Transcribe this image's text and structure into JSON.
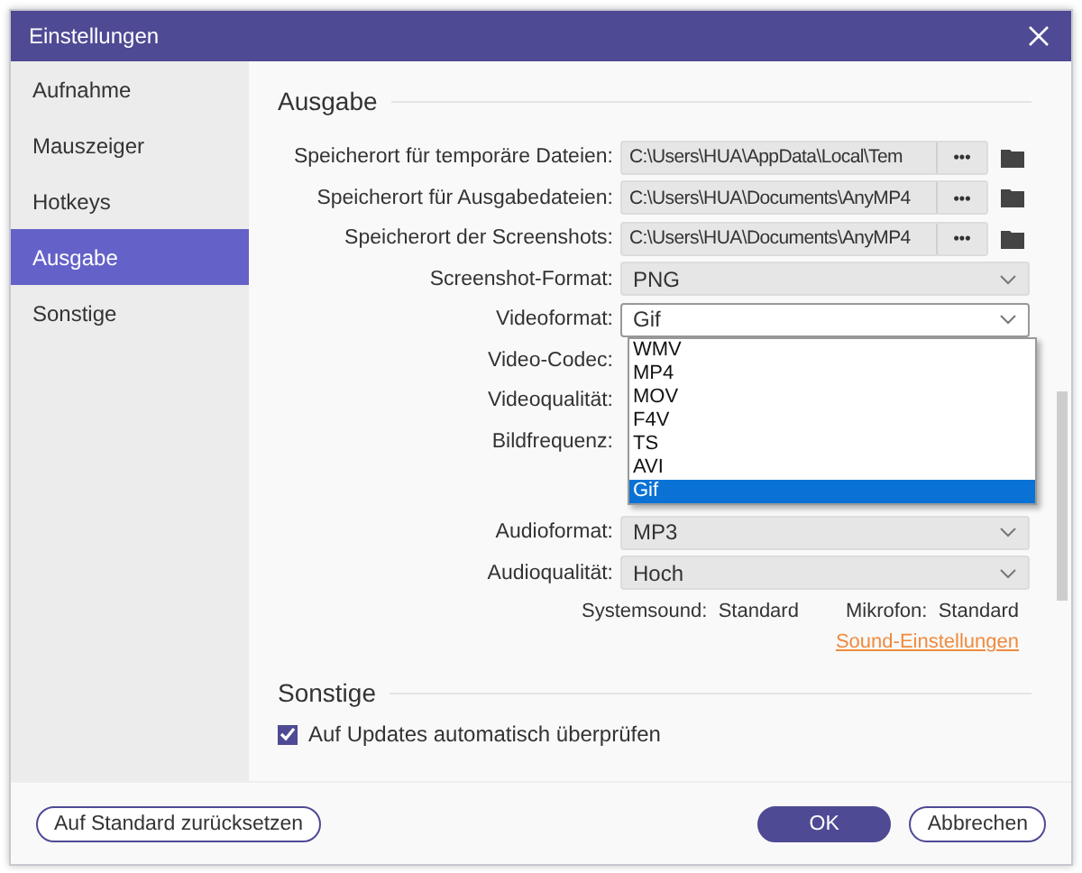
{
  "window": {
    "title": "Einstellungen"
  },
  "sidebar": {
    "items": [
      {
        "label": "Aufnahme",
        "selected": false
      },
      {
        "label": "Mauszeiger",
        "selected": false
      },
      {
        "label": "Hotkeys",
        "selected": false
      },
      {
        "label": "Ausgabe",
        "selected": true
      },
      {
        "label": "Sonstige",
        "selected": false
      }
    ]
  },
  "output": {
    "heading": "Ausgabe",
    "rows": [
      {
        "kind": "path",
        "label": "Speicherort für temporäre Dateien:",
        "value": "C:\\Users\\HUA\\AppData\\Local\\Tem",
        "button": "•••"
      },
      {
        "kind": "path",
        "label": "Speicherort für Ausgabedateien:",
        "value": "C:\\Users\\HUA\\Documents\\AnyMP4",
        "button": "•••"
      },
      {
        "kind": "path",
        "label": "Speicherort der Screenshots:",
        "value": "C:\\Users\\HUA\\Documents\\AnyMP4",
        "button": "•••"
      },
      {
        "kind": "select",
        "label": "Screenshot-Format:",
        "value": "PNG",
        "open": false
      },
      {
        "kind": "select",
        "label": "Videoformat:",
        "value": "Gif",
        "open": true,
        "options": [
          {
            "label": "WMV",
            "selected": false
          },
          {
            "label": "MP4",
            "selected": false
          },
          {
            "label": "MOV",
            "selected": false
          },
          {
            "label": "F4V",
            "selected": false
          },
          {
            "label": "TS",
            "selected": false
          },
          {
            "label": "AVI",
            "selected": false
          },
          {
            "label": "Gif",
            "selected": true
          }
        ]
      },
      {
        "kind": "covered",
        "label": "Video-Codec:"
      },
      {
        "kind": "covered",
        "label": "Videoqualität:"
      },
      {
        "kind": "covered",
        "label": "Bildfrequenz:"
      },
      {
        "kind": "spacer"
      },
      {
        "kind": "select",
        "label": "Audioformat:",
        "value": "MP3",
        "open": false
      },
      {
        "kind": "select",
        "label": "Audioqualität:",
        "value": "Hoch",
        "open": false
      }
    ],
    "sound": {
      "system_label": "Systemsound:",
      "system_value": "Standard",
      "mic_label": "Mikrofon:",
      "mic_value": "Standard",
      "link": "Sound-Einstellungen"
    }
  },
  "other": {
    "heading": "Sonstige",
    "checkbox": {
      "label": "Auf Updates automatisch überprüfen",
      "checked": true
    }
  },
  "footer": {
    "reset": "Auf Standard zurücksetzen",
    "ok": "OK",
    "cancel": "Abbrechen"
  }
}
